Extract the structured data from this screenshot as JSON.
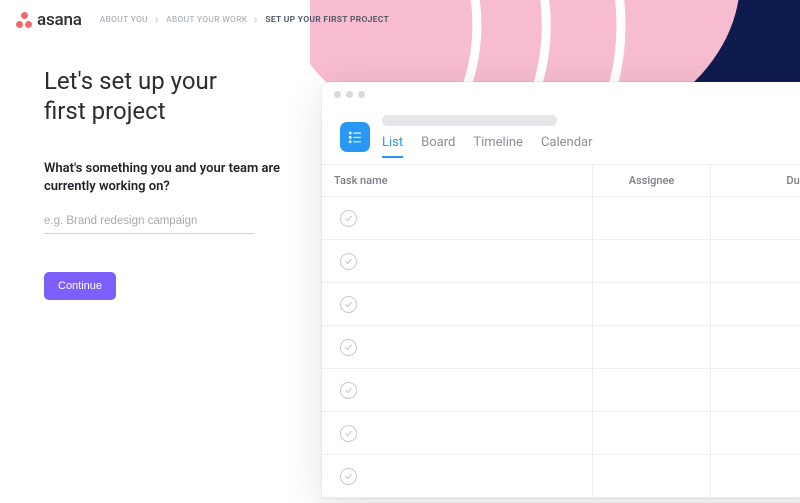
{
  "brand": {
    "name": "asana"
  },
  "breadcrumbs": {
    "items": [
      "ABOUT YOU",
      "ABOUT YOUR WORK",
      "SET UP YOUR FIRST PROJECT"
    ],
    "active_index": 2
  },
  "form": {
    "headline_line1": "Let's set up your",
    "headline_line2": "first project",
    "question": "What's something you and your team are currently working on?",
    "placeholder": "e.g. Brand redesign campaign",
    "value": "",
    "continue_label": "Continue"
  },
  "preview": {
    "tabs": [
      "List",
      "Board",
      "Timeline",
      "Calendar"
    ],
    "active_tab": 0,
    "columns": {
      "task": "Task name",
      "assignee": "Assignee",
      "due": "Due date"
    },
    "empty_row_count": 7
  },
  "colors": {
    "accent_blue": "#2997f4",
    "brand_coral": "#f06a6a",
    "button_purple": "#7e5ef8"
  }
}
